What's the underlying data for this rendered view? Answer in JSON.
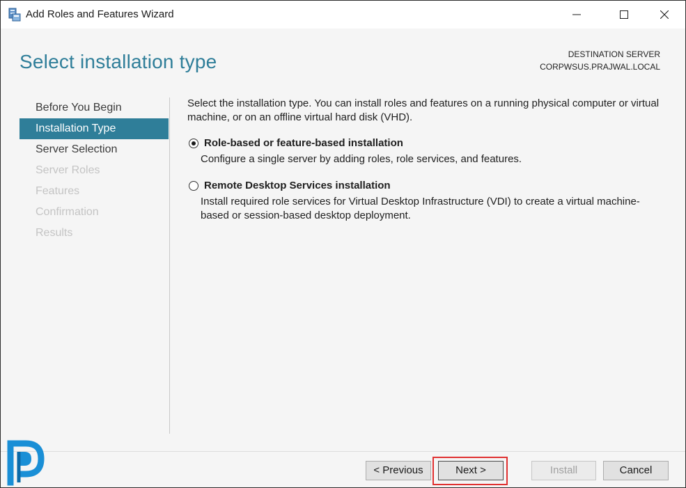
{
  "window": {
    "title": "Add Roles and Features Wizard"
  },
  "header": {
    "page_title": "Select installation type",
    "destination_label": "DESTINATION SERVER",
    "destination_server": "CORPWSUS.PRAJWAL.LOCAL"
  },
  "nav": {
    "items": [
      {
        "label": "Before You Begin",
        "state": "normal"
      },
      {
        "label": "Installation Type",
        "state": "active"
      },
      {
        "label": "Server Selection",
        "state": "normal"
      },
      {
        "label": "Server Roles",
        "state": "disabled"
      },
      {
        "label": "Features",
        "state": "disabled"
      },
      {
        "label": "Confirmation",
        "state": "disabled"
      },
      {
        "label": "Results",
        "state": "disabled"
      }
    ]
  },
  "content": {
    "intro": "Select the installation type. You can install roles and features on a running physical computer or virtual machine, or on an offline virtual hard disk (VHD).",
    "options": [
      {
        "title": "Role-based or feature-based installation",
        "description": "Configure a single server by adding roles, role services, and features.",
        "selected": true
      },
      {
        "title": "Remote Desktop Services installation",
        "description": "Install required role services for Virtual Desktop Infrastructure (VDI) to create a virtual machine-based or session-based desktop deployment.",
        "selected": false
      }
    ]
  },
  "footer": {
    "previous_label": "< Previous",
    "next_label": "Next >",
    "install_label": "Install",
    "cancel_label": "Cancel"
  },
  "colors": {
    "accent": "#2f7e99",
    "highlight_box": "#e03030"
  },
  "icons": {
    "app": "server-manager-icon",
    "logo": "prajwal-logo-icon"
  }
}
